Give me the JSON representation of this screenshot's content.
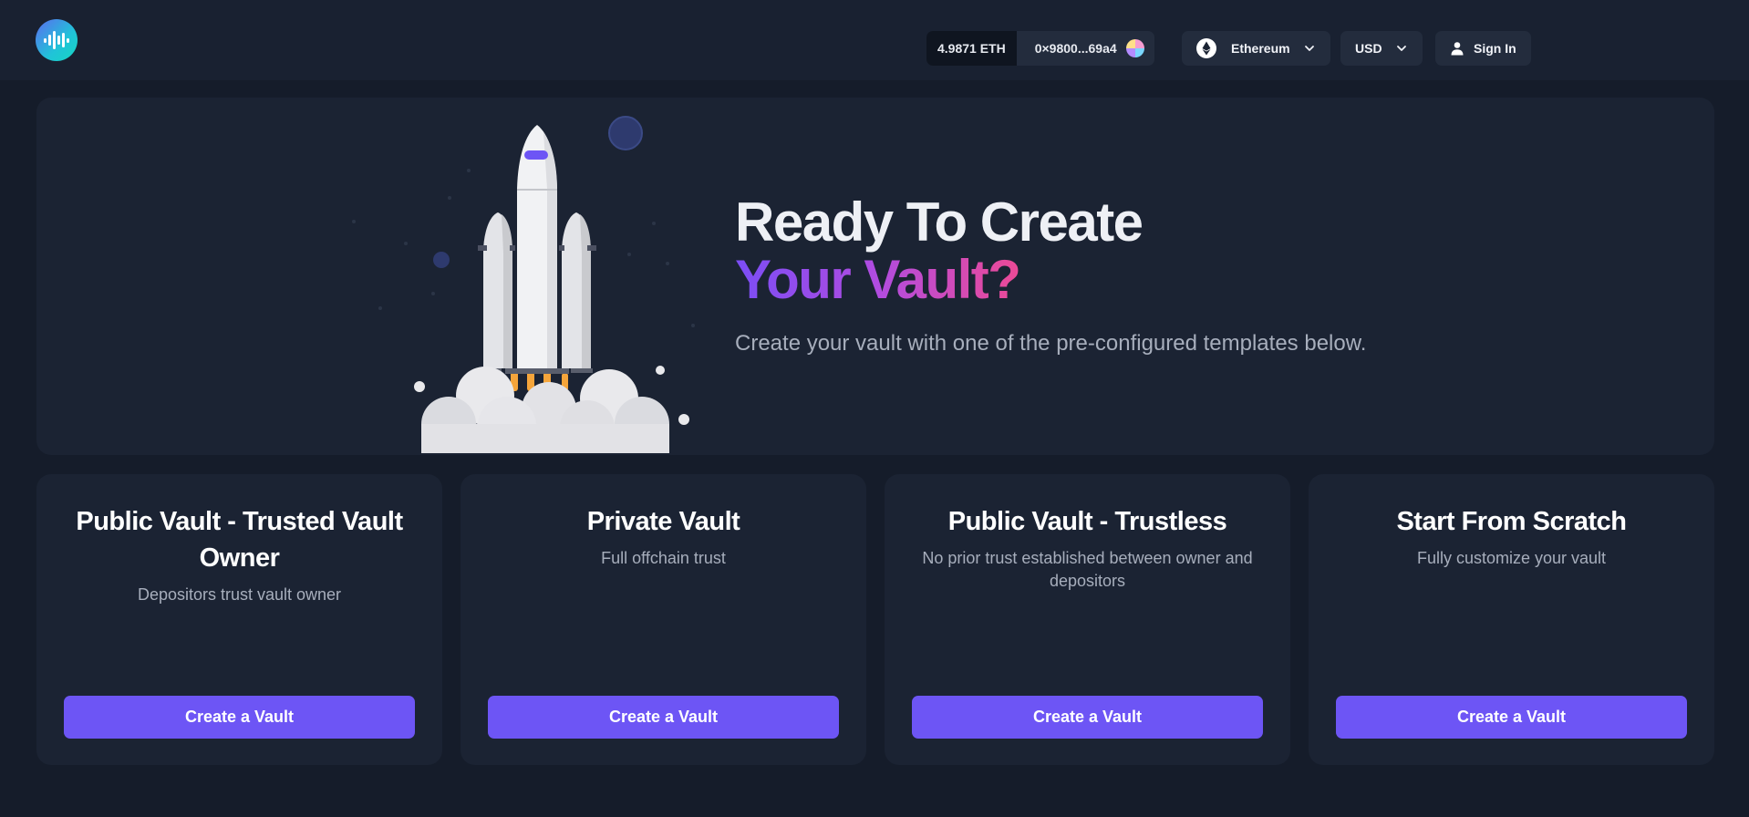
{
  "header": {
    "logo_icon": "waveform-logo-icon",
    "wallet": {
      "balance": "4.9871 ETH",
      "address": "0×9800...69a4"
    },
    "network": {
      "label": "Ethereum",
      "icon": "ethereum-icon"
    },
    "currency": {
      "label": "USD"
    },
    "sign_in": {
      "label": "Sign In",
      "icon": "user-icon"
    }
  },
  "hero": {
    "title_line1": "Ready To Create",
    "title_line2": "Your Vault?",
    "subtitle": "Create your vault with one of the pre-configured templates below.",
    "illustration": "rocket-launch-illustration"
  },
  "cards": [
    {
      "title": "Public Vault - Trusted Vault Owner",
      "description": "Depositors trust vault owner",
      "button": "Create a Vault"
    },
    {
      "title": "Private Vault",
      "description": "Full offchain trust",
      "button": "Create a Vault"
    },
    {
      "title": "Public Vault - Trustless",
      "description": "No prior trust established between owner and depositors",
      "button": "Create a Vault"
    },
    {
      "title": "Start From Scratch",
      "description": "Fully customize your vault",
      "button": "Create a Vault"
    }
  ],
  "colors": {
    "background": "#151c2a",
    "panel": "#1b2333",
    "header": "#192131",
    "accent": "#6d55f5",
    "gradient_start": "#7b4df5",
    "gradient_end": "#ec4a96"
  }
}
